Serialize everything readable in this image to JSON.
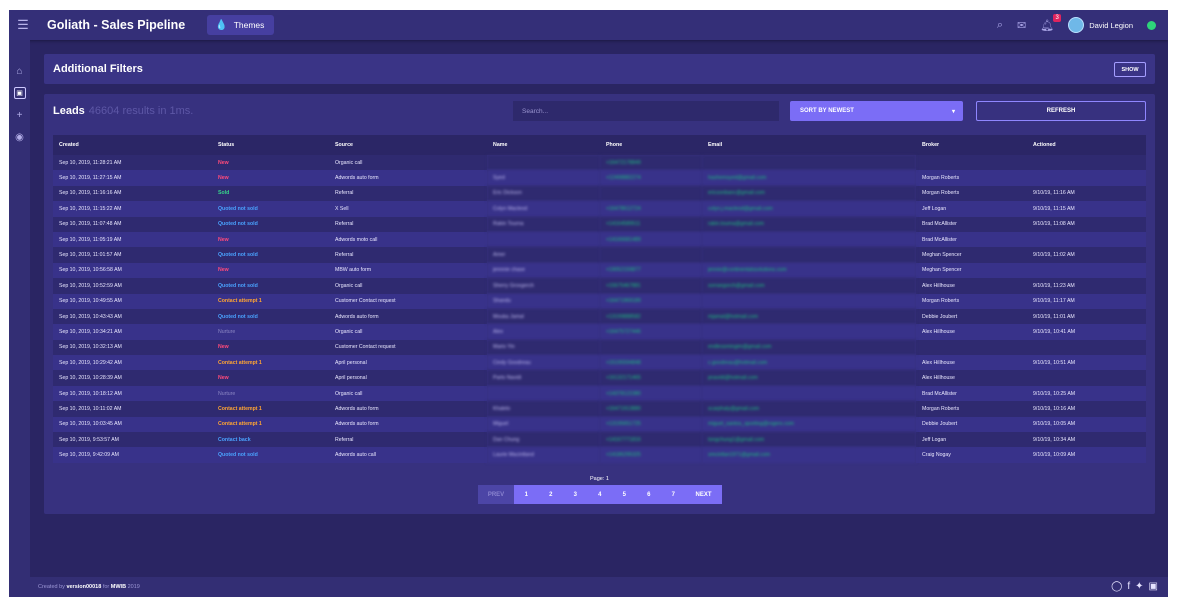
{
  "app": {
    "title": "Goliath - Sales Pipeline",
    "themes_label": "Themes",
    "user_name": "David Legion",
    "notif_count": "3"
  },
  "filters": {
    "title": "Additional Filters",
    "show_label": "SHOW"
  },
  "leads": {
    "title": "Leads",
    "count_text": "46604 results in 1ms.",
    "search_placeholder": "Search...",
    "sort_label": "SORT BY NEWEST",
    "refresh_label": "REFRESH",
    "columns": [
      "Created",
      "Status",
      "Source",
      "Name",
      "Phone",
      "Email",
      "Broker",
      "Actioned"
    ],
    "rows": [
      {
        "created": "Sep 10, 2019, 11:28:21 AM",
        "status": "New",
        "status_type": "new",
        "source": "Organic call",
        "name": "",
        "phone": "+16472178849",
        "email": "",
        "broker": "",
        "actioned": ""
      },
      {
        "created": "Sep 10, 2019, 11:27:15 AM",
        "status": "New",
        "status_type": "new",
        "source": "Adwords auto form",
        "name": "Syed",
        "phone": "+12498882274",
        "email": "hashemsyed@gmail.com",
        "broker": "Morgan Roberts",
        "actioned": ""
      },
      {
        "created": "Sep 10, 2019, 11:16:16 AM",
        "status": "Sold",
        "status_type": "sold",
        "source": "Referral",
        "name": "Eric Dickson",
        "phone": "",
        "email": "ericsonbanc@gmail.com",
        "broker": "Morgan Roberts",
        "actioned": "9/10/19, 11:16 AM"
      },
      {
        "created": "Sep 10, 2019, 11:15:22 AM",
        "status": "Quoted not sold",
        "status_type": "quoted",
        "source": "X Sell",
        "name": "Colyn Macleod",
        "phone": "+16478612724",
        "email": "colyn.j.macleod@gmail.com",
        "broker": "Jeff Logan",
        "actioned": "9/10/19, 11:15 AM"
      },
      {
        "created": "Sep 10, 2019, 11:07:48 AM",
        "status": "Quoted not sold",
        "status_type": "quoted",
        "source": "Referral",
        "name": "Rakin Tourna",
        "phone": "+14164589511",
        "email": "rakin.touma@gmail.com",
        "broker": "Brad McAllister",
        "actioned": "9/10/19, 11:08 AM"
      },
      {
        "created": "Sep 10, 2019, 11:05:19 AM",
        "status": "New",
        "status_type": "new",
        "source": "Adwords moto call",
        "name": "",
        "phone": "+14166681489",
        "email": "",
        "broker": "Brad McAllister",
        "actioned": ""
      },
      {
        "created": "Sep 10, 2019, 11:01:57 AM",
        "status": "Quoted not sold",
        "status_type": "quoted",
        "source": "Referral",
        "name": "Amer",
        "phone": "",
        "email": "",
        "broker": "Meghan Spencer",
        "actioned": "9/10/19, 11:02 AM"
      },
      {
        "created": "Sep 10, 2019, 10:56:58 AM",
        "status": "New",
        "status_type": "new",
        "source": "MBW auto form",
        "name": "jennnie chase",
        "phone": "+19052159877",
        "email": "jennie@continentalssolutions.com",
        "broker": "Meghan Spencer",
        "actioned": ""
      },
      {
        "created": "Sep 10, 2019, 10:52:59 AM",
        "status": "Quoted not sold",
        "status_type": "quoted",
        "source": "Organic call",
        "name": "Sherry Groxgerch",
        "phone": "+15675467881",
        "email": "sorraegorch@gmail.com",
        "broker": "Alex Hillhouse",
        "actioned": "9/10/19, 11:23 AM"
      },
      {
        "created": "Sep 10, 2019, 10:49:55 AM",
        "status": "Contact attempt 1",
        "status_type": "contact",
        "source": "Customer Contact request",
        "name": "Shandu",
        "phone": "+16471969189",
        "email": "",
        "broker": "Morgan Roberts",
        "actioned": "9/10/19, 11:17 AM"
      },
      {
        "created": "Sep 10, 2019, 10:43:43 AM",
        "status": "Quoted not sold",
        "status_type": "quoted",
        "source": "Adwords auto form",
        "name": "Mouka Jamal",
        "phone": "+13199888582",
        "email": "mjamal@hotmail.com",
        "broker": "Debbie Joubert",
        "actioned": "9/10/19, 11:01 AM"
      },
      {
        "created": "Sep 10, 2019, 10:34:21 AM",
        "status": "Nurture",
        "status_type": "nurture",
        "source": "Organic call",
        "name": "Alex",
        "phone": "+16475727446",
        "email": "",
        "broker": "Alex Hillhouse",
        "actioned": "9/10/19, 10:41 AM"
      },
      {
        "created": "Sep 10, 2019, 10:32:13 AM",
        "status": "New",
        "status_type": "new",
        "source": "Customer Contact request",
        "name": "Mario Yin",
        "phone": "",
        "email": "endlessmingim@gmail.com",
        "broker": "",
        "actioned": ""
      },
      {
        "created": "Sep 10, 2019, 10:29:42 AM",
        "status": "Contact attempt 1",
        "status_type": "contact",
        "source": "April personal",
        "name": "Cindy Goodreau",
        "phone": "+15195594848",
        "email": "c.goodreau@hotmail.com",
        "broker": "Alex Hillhouse",
        "actioned": "9/10/19, 10:51 AM"
      },
      {
        "created": "Sep 10, 2019, 10:28:39 AM",
        "status": "New",
        "status_type": "new",
        "source": "April personal",
        "name": "Parto Navidi",
        "phone": "+16132171465",
        "email": "pnavidi@hotmail.com",
        "broker": "Alex Hillhouse",
        "actioned": ""
      },
      {
        "created": "Sep 10, 2019, 10:18:12 AM",
        "status": "Nurture",
        "status_type": "nurture",
        "source": "Organic call",
        "name": "",
        "phone": "+14378122380",
        "email": "",
        "broker": "Brad McAllister",
        "actioned": "9/10/19, 10:25 AM"
      },
      {
        "created": "Sep 10, 2019, 10:11:02 AM",
        "status": "Contact attempt 1",
        "status_type": "contact",
        "source": "Adwords auto form",
        "name": "Khalelo",
        "phone": "+16471913880",
        "email": "scarphaly@gmail.com",
        "broker": "Morgan Roberts",
        "actioned": "9/10/19, 10:16 AM"
      },
      {
        "created": "Sep 10, 2019, 10:03:45 AM",
        "status": "Contact attempt 1",
        "status_type": "contact",
        "source": "Adwords auto form",
        "name": "Miguel",
        "phone": "+13195651725",
        "email": "miguel_santos_sporting@rogers.com",
        "broker": "Debbie Joubert",
        "actioned": "9/10/19, 10:05 AM"
      },
      {
        "created": "Sep 10, 2019, 9:53:57 AM",
        "status": "Contact back",
        "status_type": "back",
        "source": "Referral",
        "name": "Dan Chung",
        "phone": "+14167771816",
        "email": "tongchung1@gmail.com",
        "broker": "Jeff Logan",
        "actioned": "9/10/19, 10:34 AM"
      },
      {
        "created": "Sep 10, 2019, 9:42:09 AM",
        "status": "Quoted not sold",
        "status_type": "quoted",
        "source": "Adwords auto call",
        "name": "Laurie Macintland",
        "phone": "+14186295325",
        "email": "smcinllan1971@gmail.com",
        "broker": "Craig Nogay",
        "actioned": "9/10/19, 10:09 AM"
      }
    ]
  },
  "pagination": {
    "label": "Page: 1",
    "prev": "PREV",
    "pages": [
      "1",
      "2",
      "3",
      "4",
      "5",
      "6",
      "7"
    ],
    "next": "NEXT"
  },
  "footer": {
    "prefix": "Created by ",
    "author": "version00018",
    "mid": " for ",
    "org": "MWIB",
    "year": " 2019"
  },
  "colors": {
    "accent": "#7b6df6",
    "background": "#2a2563",
    "panel": "#37317f",
    "new": "#ff4a7a",
    "quoted": "#4aa3ff",
    "sold": "#36d68a",
    "contact": "#ffa533"
  }
}
